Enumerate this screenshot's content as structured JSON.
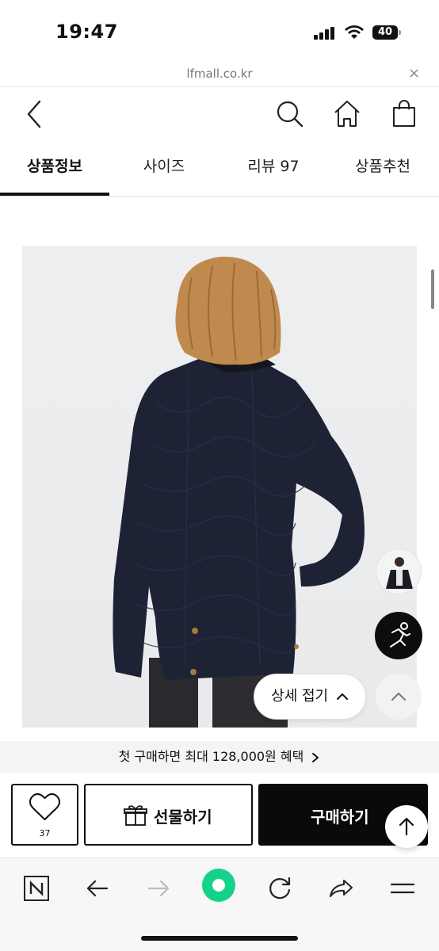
{
  "status_bar": {
    "time": "19:47",
    "battery": "40"
  },
  "url_bar": {
    "url": "lfmall.co.kr",
    "close": "×"
  },
  "header": {
    "icons": [
      "back-arrow-icon",
      "search-icon",
      "home-icon",
      "shopping-bag-icon"
    ]
  },
  "tabs": [
    {
      "label": "상품정보",
      "active": true
    },
    {
      "label": "사이즈",
      "active": false
    },
    {
      "label": "리뷰 97",
      "active": false
    },
    {
      "label": "상품추천",
      "active": false
    }
  ],
  "product": {
    "collapse_label": "상세 접기"
  },
  "promo": {
    "text": "첫 구매하면 최대 128,000원 혜택"
  },
  "actions": {
    "wish_count": "37",
    "gift_label": "선물하기",
    "buy_label": "구매하기"
  },
  "colors": {
    "primary": "#0a0a0a",
    "accent_green": "#13d38b",
    "jacket": "#1e2235"
  }
}
